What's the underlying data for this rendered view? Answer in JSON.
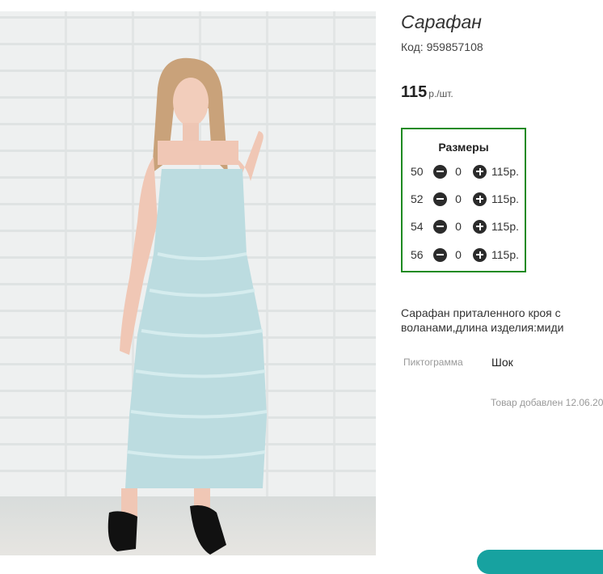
{
  "product": {
    "title": "Сарафан",
    "code": "Код: 959857108",
    "price": "115",
    "price_unit": "р./шт.",
    "description": "Сарафан приталенного кроя с воланами,длина изделия:миди"
  },
  "sizes": {
    "title": "Размеры",
    "rows": [
      {
        "size": "50",
        "qty": "0",
        "price": "115р."
      },
      {
        "size": "52",
        "qty": "0",
        "price": "115р."
      },
      {
        "size": "54",
        "qty": "0",
        "price": "115р."
      },
      {
        "size": "56",
        "qty": "0",
        "price": "115р."
      }
    ]
  },
  "pictogram": {
    "label": "Пиктограмма",
    "value": "Шок"
  },
  "added": "Товар добавлен 12.06.20",
  "icons": {
    "minus": "minus-circle-icon",
    "plus": "plus-circle-icon"
  },
  "colors": {
    "sizes_border": "#1e8a21",
    "dress": "#bcdce0"
  }
}
